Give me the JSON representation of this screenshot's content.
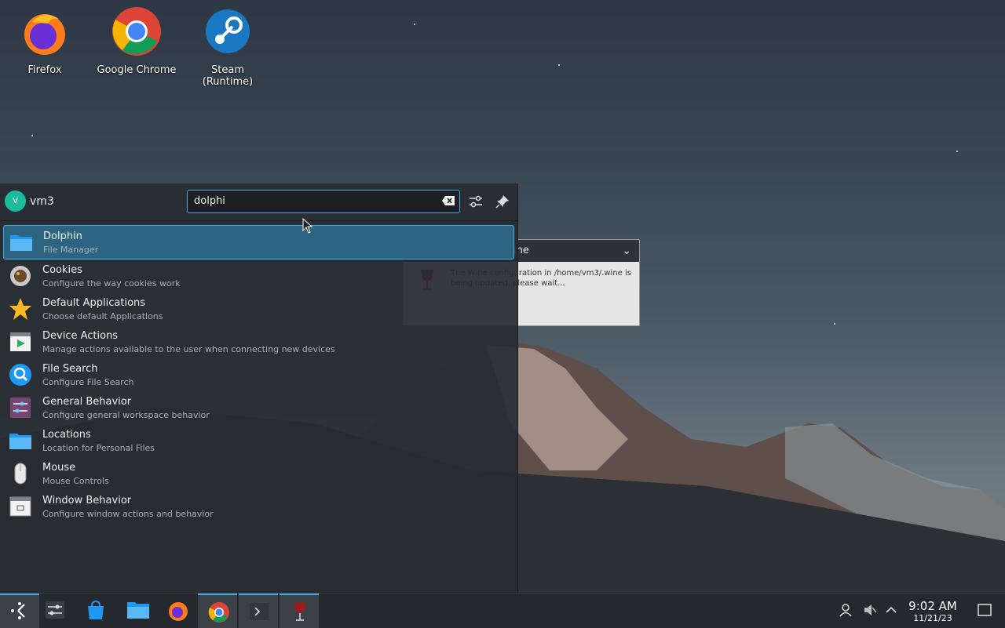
{
  "desktop": {
    "icons": [
      {
        "label": "Firefox"
      },
      {
        "label": "Google Chrome"
      },
      {
        "label": "Steam (Runtime)"
      }
    ]
  },
  "wine_dialog": {
    "title": "ine",
    "message": "The Wine configuration in /home/vm3/.wine is being updated, please wait..."
  },
  "launcher": {
    "user": {
      "initial": "V",
      "name": "vm3"
    },
    "search": {
      "value": "dolphi"
    },
    "results": [
      {
        "title": "Dolphin",
        "subtitle": "File Manager",
        "icon": "folder-icon",
        "selected": true
      },
      {
        "title": "Cookies",
        "subtitle": "Configure the way cookies work",
        "icon": "cookie-icon"
      },
      {
        "title": "Default Applications",
        "subtitle": "Choose default Applications",
        "icon": "star-icon"
      },
      {
        "title": "Device Actions",
        "subtitle": "Manage actions available to the user when connecting new devices",
        "icon": "device-actions-icon"
      },
      {
        "title": "File Search",
        "subtitle": "Configure File Search",
        "icon": "file-search-icon"
      },
      {
        "title": "General Behavior",
        "subtitle": "Configure general workspace behavior",
        "icon": "general-behavior-icon"
      },
      {
        "title": "Locations",
        "subtitle": "Location for Personal Files",
        "icon": "folder-icon"
      },
      {
        "title": "Mouse",
        "subtitle": "Mouse Controls",
        "icon": "mouse-icon"
      },
      {
        "title": "Window Behavior",
        "subtitle": "Configure window actions and behavior",
        "icon": "window-behavior-icon"
      }
    ]
  },
  "taskbar": {
    "clock": {
      "time": "9:02 AM",
      "date": "11/21/23"
    }
  },
  "colors": {
    "accent": "#3daee9",
    "selection": "#2d6482",
    "panel": "#25282d"
  }
}
